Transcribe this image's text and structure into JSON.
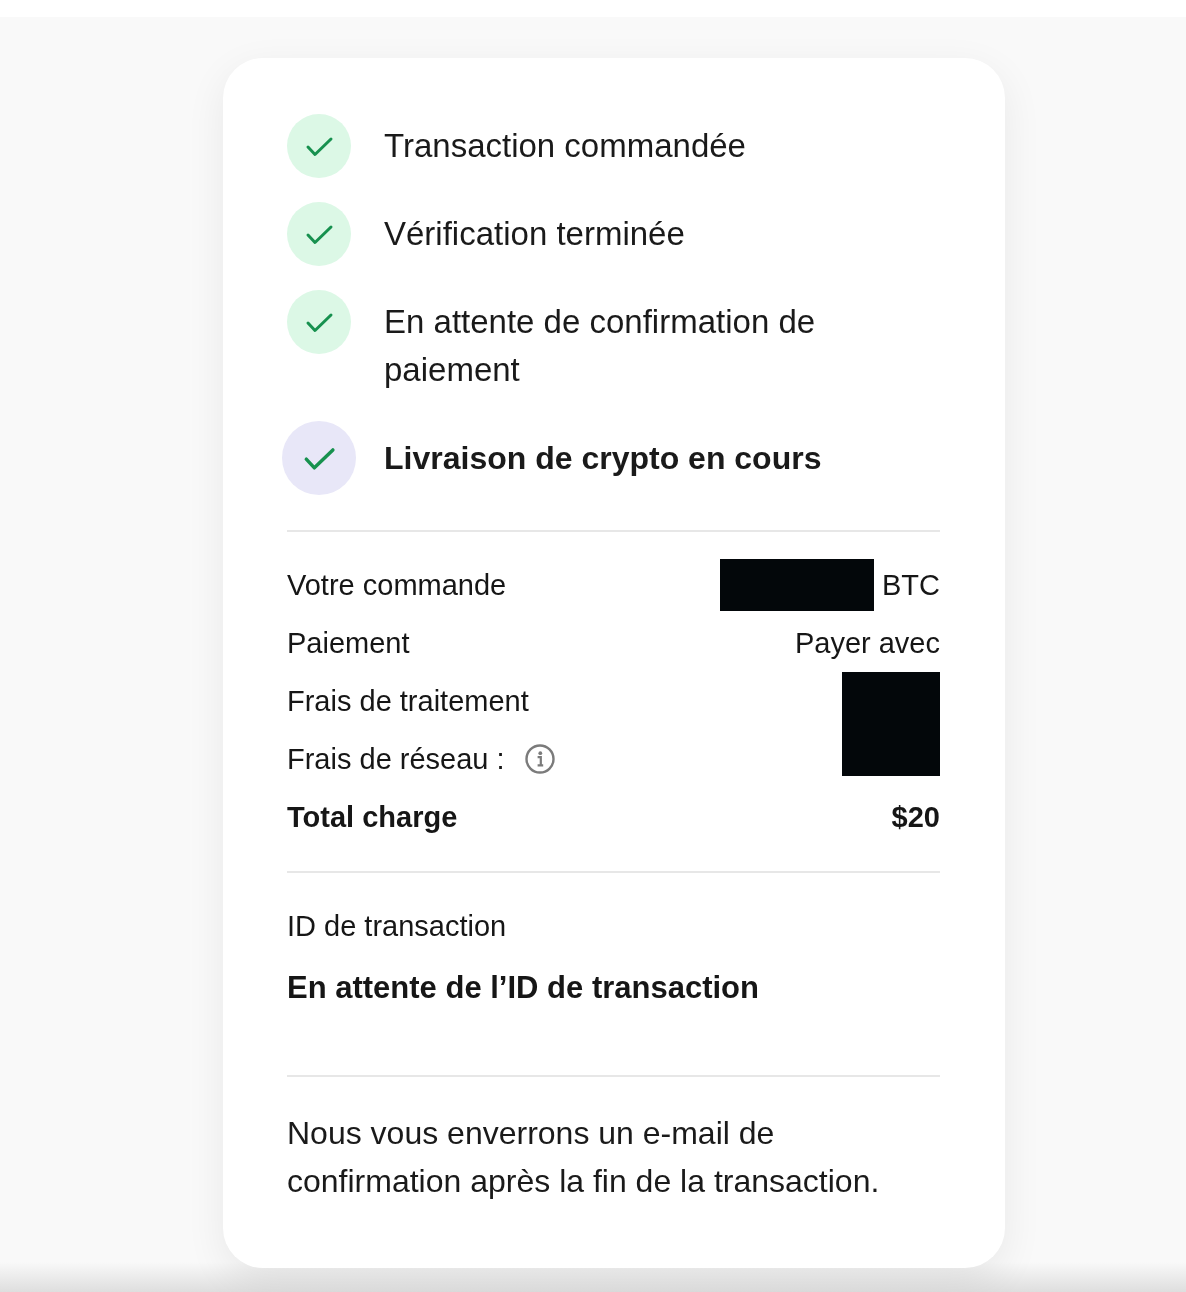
{
  "steps": [
    {
      "label": "Transaction commandée",
      "done": true,
      "current": false
    },
    {
      "label": "Vérification terminée",
      "done": true,
      "current": false
    },
    {
      "label": "En attente de confirmation de paiement",
      "done": true,
      "current": false
    },
    {
      "label": "Livraison de crypto en cours",
      "done": true,
      "current": true
    }
  ],
  "summary": {
    "rows": [
      {
        "kind": "line",
        "label": "Votre commande",
        "info": false,
        "redacted": true,
        "value": "BTC"
      },
      {
        "kind": "line",
        "label": "Paiement",
        "info": false,
        "redacted": false,
        "value": "Payer avec"
      },
      {
        "kind": "line",
        "label": "Frais de traitement",
        "info": false,
        "redacted": true
      },
      {
        "kind": "line",
        "label": "Frais de réseau :",
        "info": true,
        "redacted": true
      },
      {
        "kind": "total",
        "label": "Total charge",
        "info": false,
        "redacted": false,
        "value": "$20"
      }
    ]
  },
  "transaction": {
    "label": "ID de transaction",
    "value": "En attente de l’ID de transaction"
  },
  "note": "Nous vous enverrons un e-mail de confirmation après la fin de la transaction."
}
